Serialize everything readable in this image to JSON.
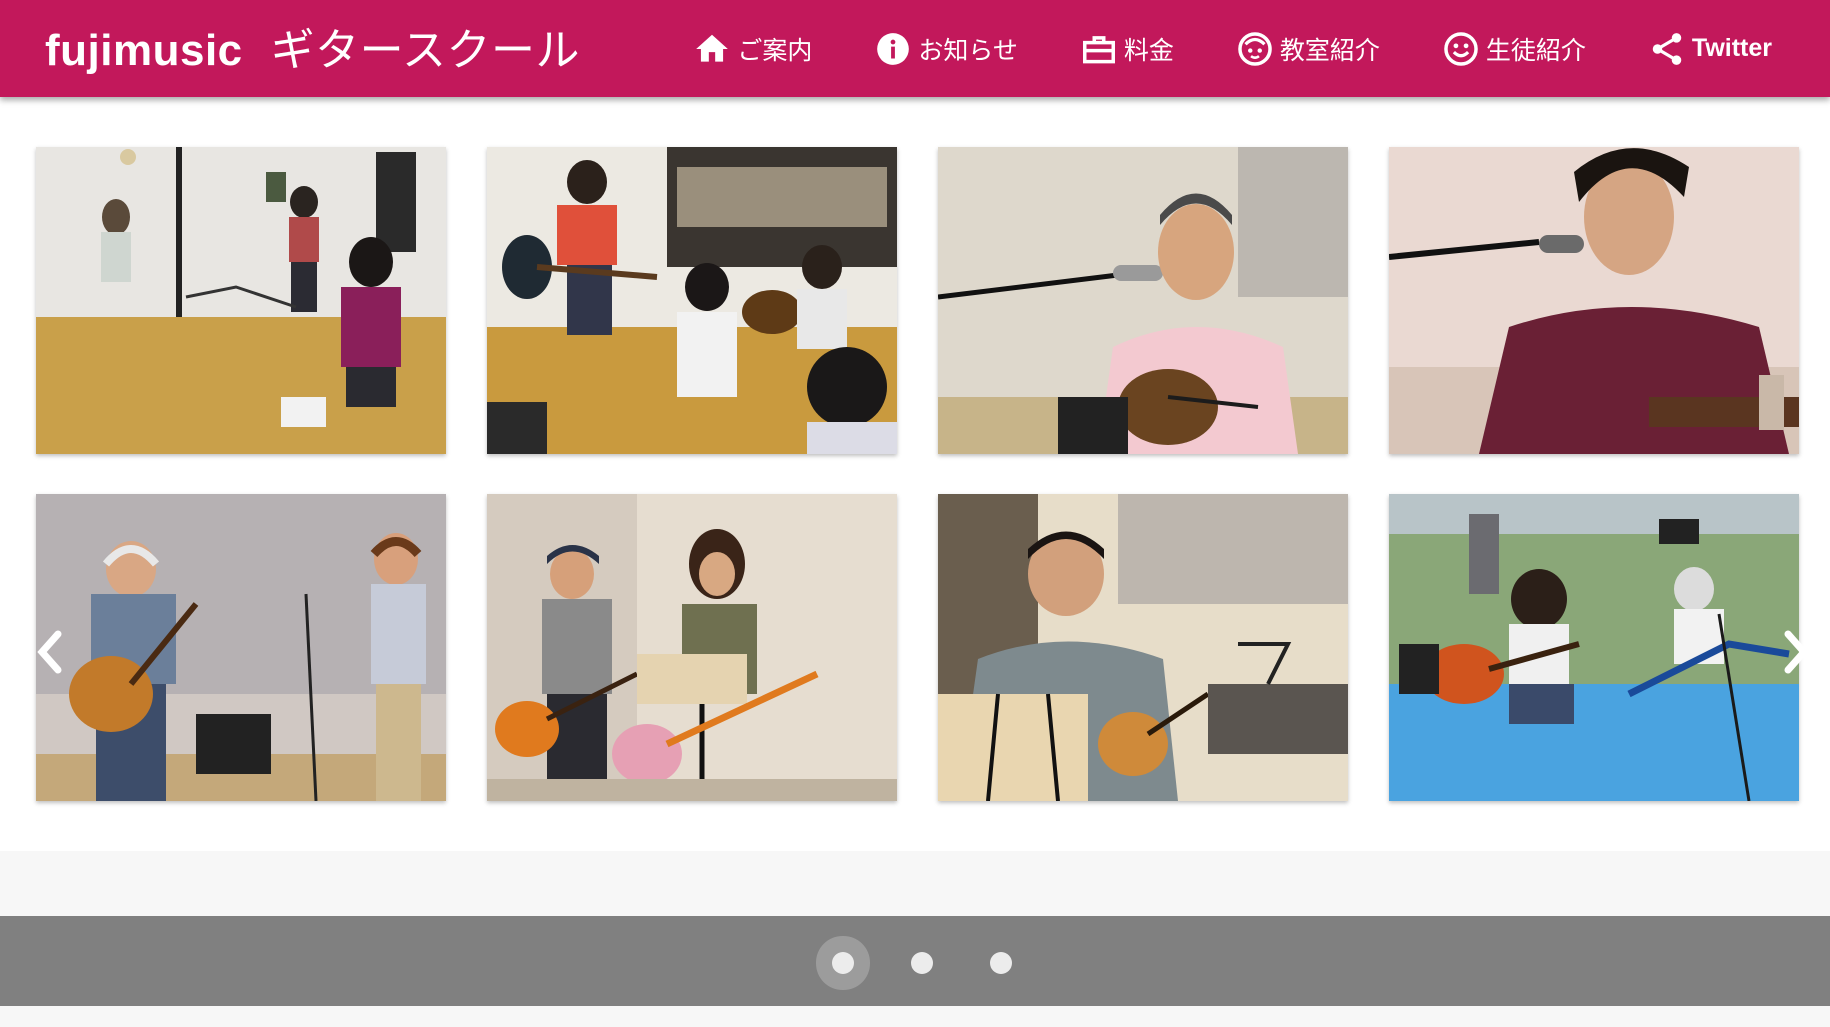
{
  "site": {
    "name": "fujimusic",
    "subtitle": "ギタースクール"
  },
  "nav": {
    "items": [
      {
        "label": "ご案内",
        "icon": "home-icon"
      },
      {
        "label": "お知らせ",
        "icon": "info-icon"
      },
      {
        "label": "料金",
        "icon": "briefcase-icon"
      },
      {
        "label": "教室紹介",
        "icon": "child-face-icon"
      },
      {
        "label": "生徒紹介",
        "icon": "smiley-icon"
      },
      {
        "label": "Twitter",
        "icon": "share-icon"
      }
    ]
  },
  "colors": {
    "header": "#c2185b",
    "pager_bar": "#808080",
    "dot": "#ececec"
  },
  "gallery": {
    "photos": [
      {
        "subject": "students practicing guitar in a practice room"
      },
      {
        "subject": "group guitar lesson seated on the floor"
      },
      {
        "subject": "man in pink shirt singing with acoustic guitar"
      },
      {
        "subject": "young man singing into a microphone with guitar"
      },
      {
        "subject": "older man with acoustic guitar and woman on stage"
      },
      {
        "subject": "duo performing with electric guitar and music stand"
      },
      {
        "subject": "man in checked shirt singing with acoustic guitar"
      },
      {
        "subject": "outdoor performance on blue tarp stage"
      }
    ],
    "prev_icon": "chevron-left-icon",
    "next_icon": "chevron-right-icon"
  },
  "pager": {
    "pages": 3,
    "active": 1
  }
}
